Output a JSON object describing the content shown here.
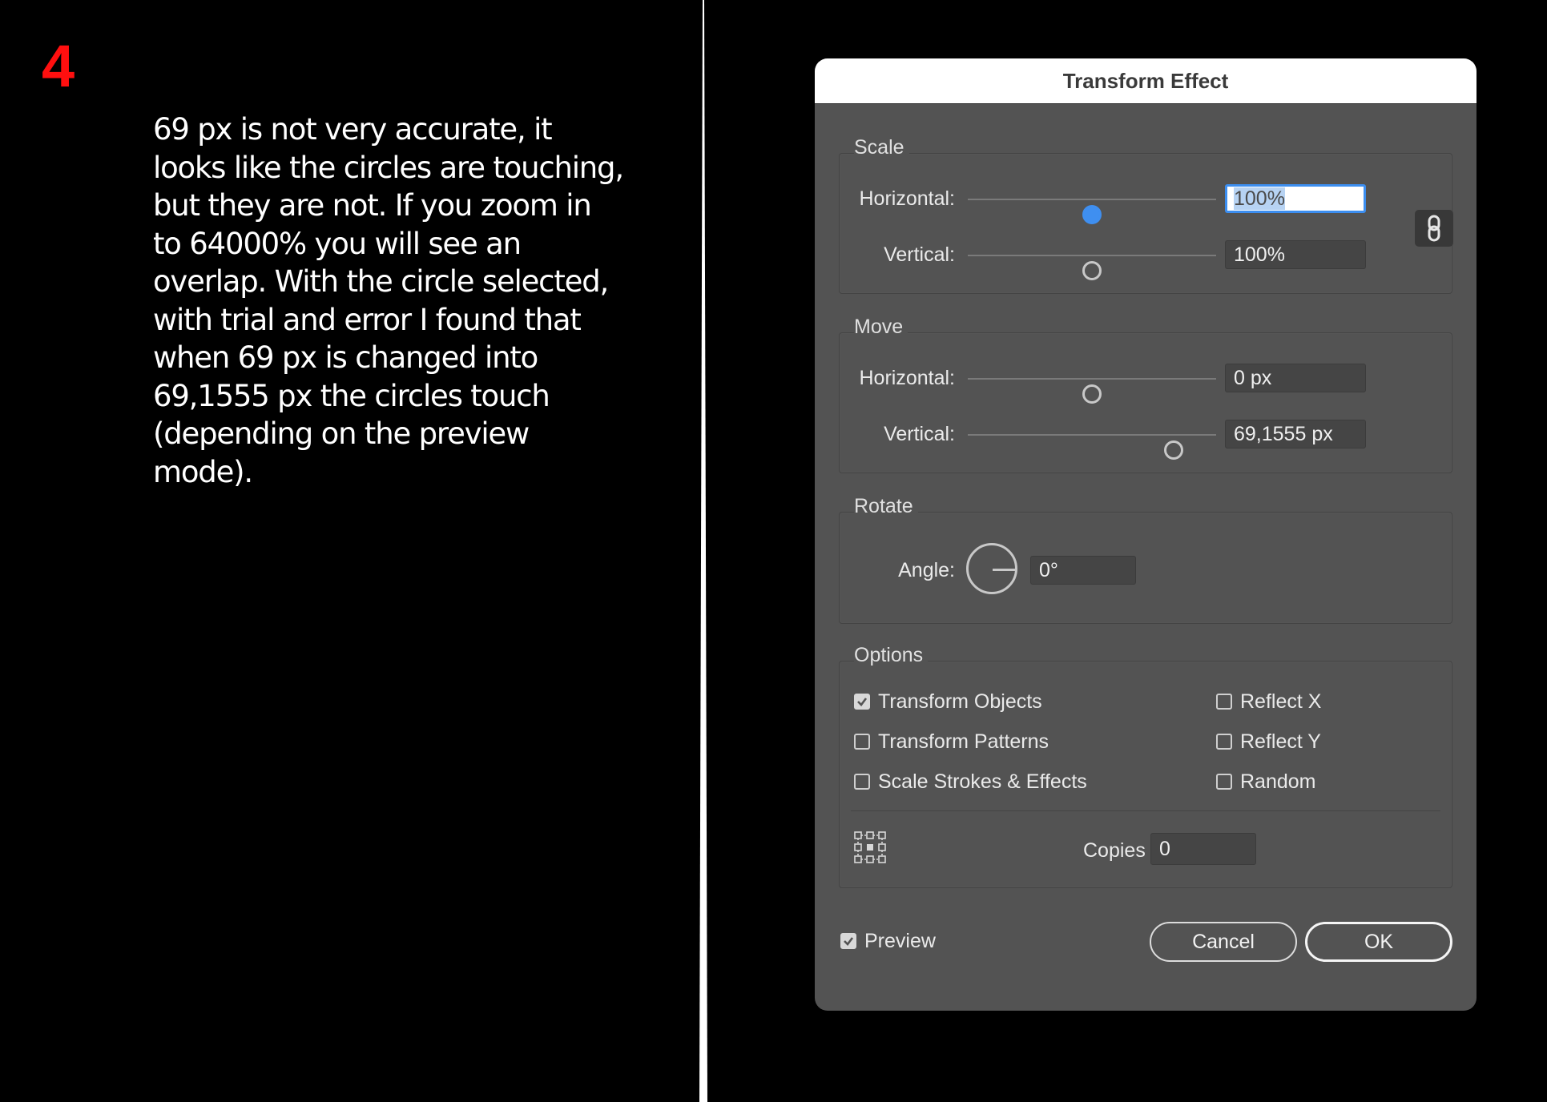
{
  "annotation": {
    "step_number": "4",
    "lines": [
      "69 px  is not very accurate, it",
      "looks like the circles are touching,",
      "but they are not. If you zoom in",
      "to 64000% you will see an",
      "overlap. With the circle selected,",
      "with trial and error I found that",
      "when 69 px is changed into",
      "69,1555 px the circles touch",
      "(depending on the preview",
      "mode)."
    ]
  },
  "dialog": {
    "title": "Transform Effect",
    "scale": {
      "label": "Scale",
      "horizontal": {
        "label": "Horizontal:",
        "value": "100%",
        "slider_fraction": 0.5
      },
      "vertical": {
        "label": "Vertical:",
        "value": "100%",
        "slider_fraction": 0.5
      },
      "constrain_icon": "link-icon"
    },
    "move": {
      "label": "Move",
      "horizontal": {
        "label": "Horizontal:",
        "value": "0 px",
        "slider_fraction": 0.5
      },
      "vertical": {
        "label": "Vertical:",
        "value": "69,1555 px",
        "slider_fraction": 0.83
      }
    },
    "rotate": {
      "label": "Rotate",
      "angle": {
        "label": "Angle:",
        "value": "0°"
      }
    },
    "options": {
      "label": "Options",
      "checkboxes": [
        {
          "label": "Transform Objects",
          "checked": true
        },
        {
          "label": "Transform Patterns",
          "checked": false
        },
        {
          "label": "Scale Strokes & Effects",
          "checked": false
        },
        {
          "label": "Reflect X",
          "checked": false
        },
        {
          "label": "Reflect Y",
          "checked": false
        },
        {
          "label": "Random",
          "checked": false
        }
      ],
      "reference_point_icon": "reference-point-grid-icon",
      "copies": {
        "label": "Copies",
        "value": "0"
      }
    },
    "preview": {
      "label": "Preview",
      "checked": true
    },
    "buttons": {
      "cancel": "Cancel",
      "ok": "OK"
    }
  }
}
